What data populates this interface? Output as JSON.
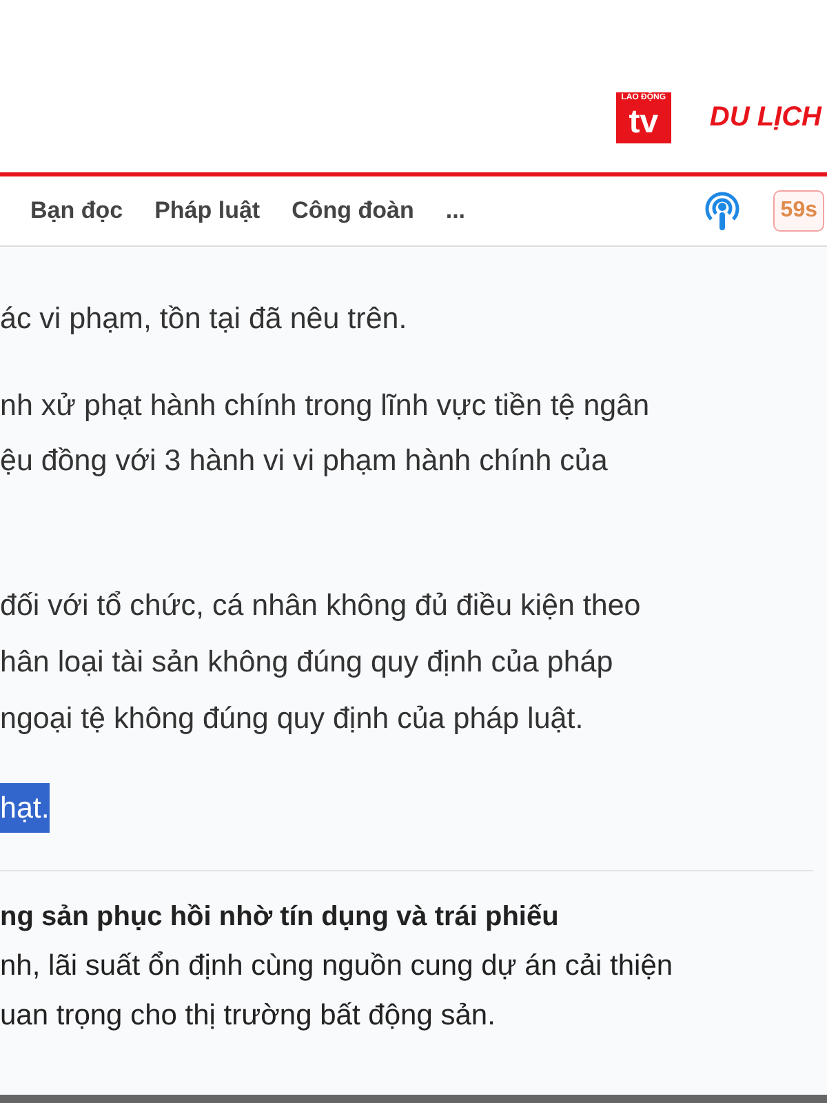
{
  "header": {
    "logo_tv": {
      "top": "LAO ĐỘNG",
      "main": "tv"
    },
    "logo_travel": "DU LỊCH"
  },
  "nav": {
    "items": [
      "Bạn đọc",
      "Pháp luật",
      "Công đoàn",
      "..."
    ],
    "timer": "59s"
  },
  "paragraphs": [
    {
      "lines": [
        "ác vi phạm, tồn tại đã nêu trên."
      ]
    },
    {
      "lines": [
        "nh xử phạt hành chính trong lĩnh vực tiền tệ ngân",
        "ệu đồng với 3 hành vi vi phạm hành chính của"
      ]
    },
    {
      "lines": [
        "đối với tổ chức, cá nhân không đủ điều kiện theo",
        "hân loại tài sản không đúng quy định của pháp",
        "ngoại tệ không đúng quy định của pháp luật."
      ]
    },
    {
      "lines": [
        "hạt."
      ],
      "selected": true
    }
  ],
  "related": {
    "title": "ng sản phục hồi nhờ tín dụng và trái phiếu",
    "summary": [
      "nh, lãi suất ổn định cùng nguồn cung dự án cải thiện",
      "uan trọng cho thị trường bất động sản."
    ]
  }
}
